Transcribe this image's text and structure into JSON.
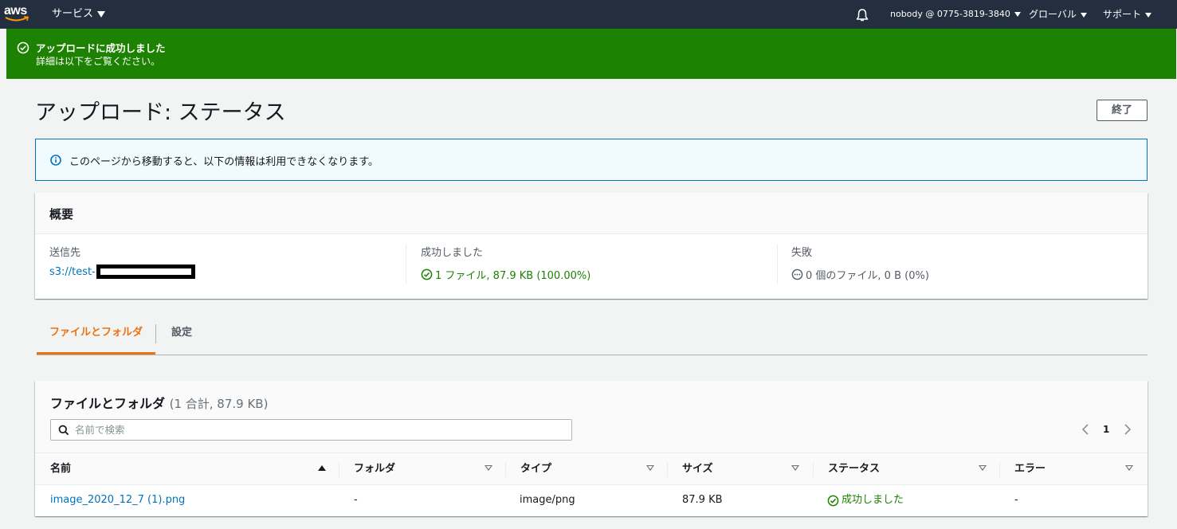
{
  "nav": {
    "logo_text": "aws",
    "services_label": "サービス",
    "account_label": "nobody @ 0775-3819-3840",
    "region_label": "グローバル",
    "support_label": "サポート"
  },
  "flash": {
    "title": "アップロードに成功しました",
    "subtitle": "詳細は以下をご覧ください。"
  },
  "page": {
    "title": "アップロード: ステータス",
    "finish_button": "終了"
  },
  "info": {
    "text": "このページから移動すると、以下の情報は利用できなくなります。"
  },
  "summary": {
    "title": "概要",
    "destination_label": "送信先",
    "destination_value": "s3://test-",
    "succeeded_label": "成功しました",
    "succeeded_value": "1 ファイル, 87.9 KB (100.00%)",
    "failed_label": "失敗",
    "failed_value": "0 個のファイル, 0 B (0%)"
  },
  "tabs": [
    {
      "label": "ファイルとフォルダ",
      "active": true
    },
    {
      "label": "設定",
      "active": false
    }
  ],
  "files": {
    "title": "ファイルとフォルダ",
    "count": "(1 合計, 87.9 KB)",
    "search_placeholder": "名前で検索",
    "current_page": "1",
    "columns": [
      "名前",
      "フォルダ",
      "タイプ",
      "サイズ",
      "ステータス",
      "エラー"
    ],
    "rows": [
      {
        "name": "image_2020_12_7 (1).png",
        "folder": "-",
        "type": "image/png",
        "size": "87.9 KB",
        "status": "成功しました",
        "error": "-"
      }
    ]
  },
  "colors": {
    "nav_bg": "#232f3e",
    "success": "#1d8102",
    "link": "#0073bb",
    "tab_active": "#ec7211",
    "info_bg": "#f1faff"
  }
}
